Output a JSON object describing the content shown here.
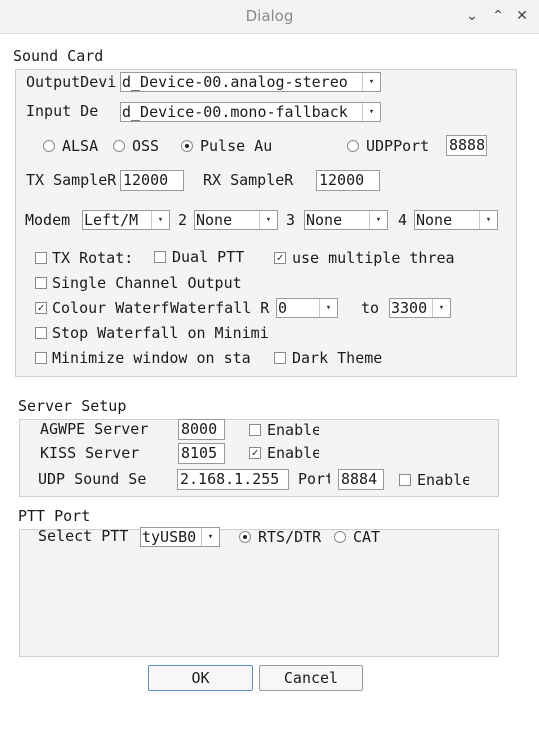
{
  "window": {
    "title": "Dialog",
    "minimize_glyph": "⌄",
    "maximize_glyph": "⌃",
    "close_glyph": "✕"
  },
  "sound_card": {
    "heading": "Sound Card",
    "output_label": "OutputDevi",
    "output_value": "d_Device-00.analog-stereo",
    "input_label": "Input De",
    "input_value": "d_Device-00.mono-fallback",
    "radios": {
      "alsa": "ALSA",
      "oss": "OSS",
      "pulse": "Pulse Au",
      "udp": "UDPPort",
      "selected": "pulse"
    },
    "udp_port": "8888",
    "tx_rate_label": "TX SampleR",
    "tx_rate": "12000",
    "rx_rate_label": "RX SampleR",
    "rx_rate": "12000",
    "modem_label": "Modem",
    "modem1": "Left/M",
    "modem2_label": "2",
    "modem2": "None",
    "modem3_label": "3",
    "modem3": "None",
    "modem4_label": "4",
    "modem4": "None",
    "tx_rotate": "TX Rotat:",
    "dual_ptt": "Dual PTT",
    "multi_thread": "use multiple threa",
    "single_channel": "Single Channel Output",
    "colour_waterfall": "Colour Waterf",
    "waterfall_range": "Waterfall R",
    "waterfall_from": "0",
    "waterfall_to_label": "to",
    "waterfall_to": "3300",
    "stop_waterfall": "Stop Waterfall on Minimi",
    "minimize_start": "Minimize window on sta",
    "dark_theme": "Dark Theme",
    "checks": {
      "tx_rotate": false,
      "dual_ptt": false,
      "multi_thread": true,
      "single_channel": false,
      "colour_waterfall": true,
      "stop_waterfall": false,
      "minimize_start": false,
      "dark_theme": false
    }
  },
  "server": {
    "heading": "Server Setup",
    "agwpe_label": "AGWPE Server",
    "agwpe_port": "8000",
    "agwpe_enable": "Enable",
    "agwpe_checked": false,
    "kiss_label": "KISS Server",
    "kiss_port": "8105",
    "kiss_enable": "Enable",
    "kiss_checked": true,
    "udp_label": "UDP Sound Se",
    "udp_host": "2.168.1.255",
    "udp_port_label": "Port",
    "udp_port": "8884",
    "udp_enable": "Enable",
    "udp_checked": false
  },
  "ptt": {
    "heading": "PTT Port",
    "select_label": "Select PTT",
    "port_value": "tyUSB0",
    "rts_label": "RTS/DTR",
    "cat_label": "CAT",
    "selected": "rts"
  },
  "buttons": {
    "ok": "OK",
    "cancel": "Cancel"
  },
  "icons": {
    "dropdown": "▾",
    "check": "✓"
  }
}
